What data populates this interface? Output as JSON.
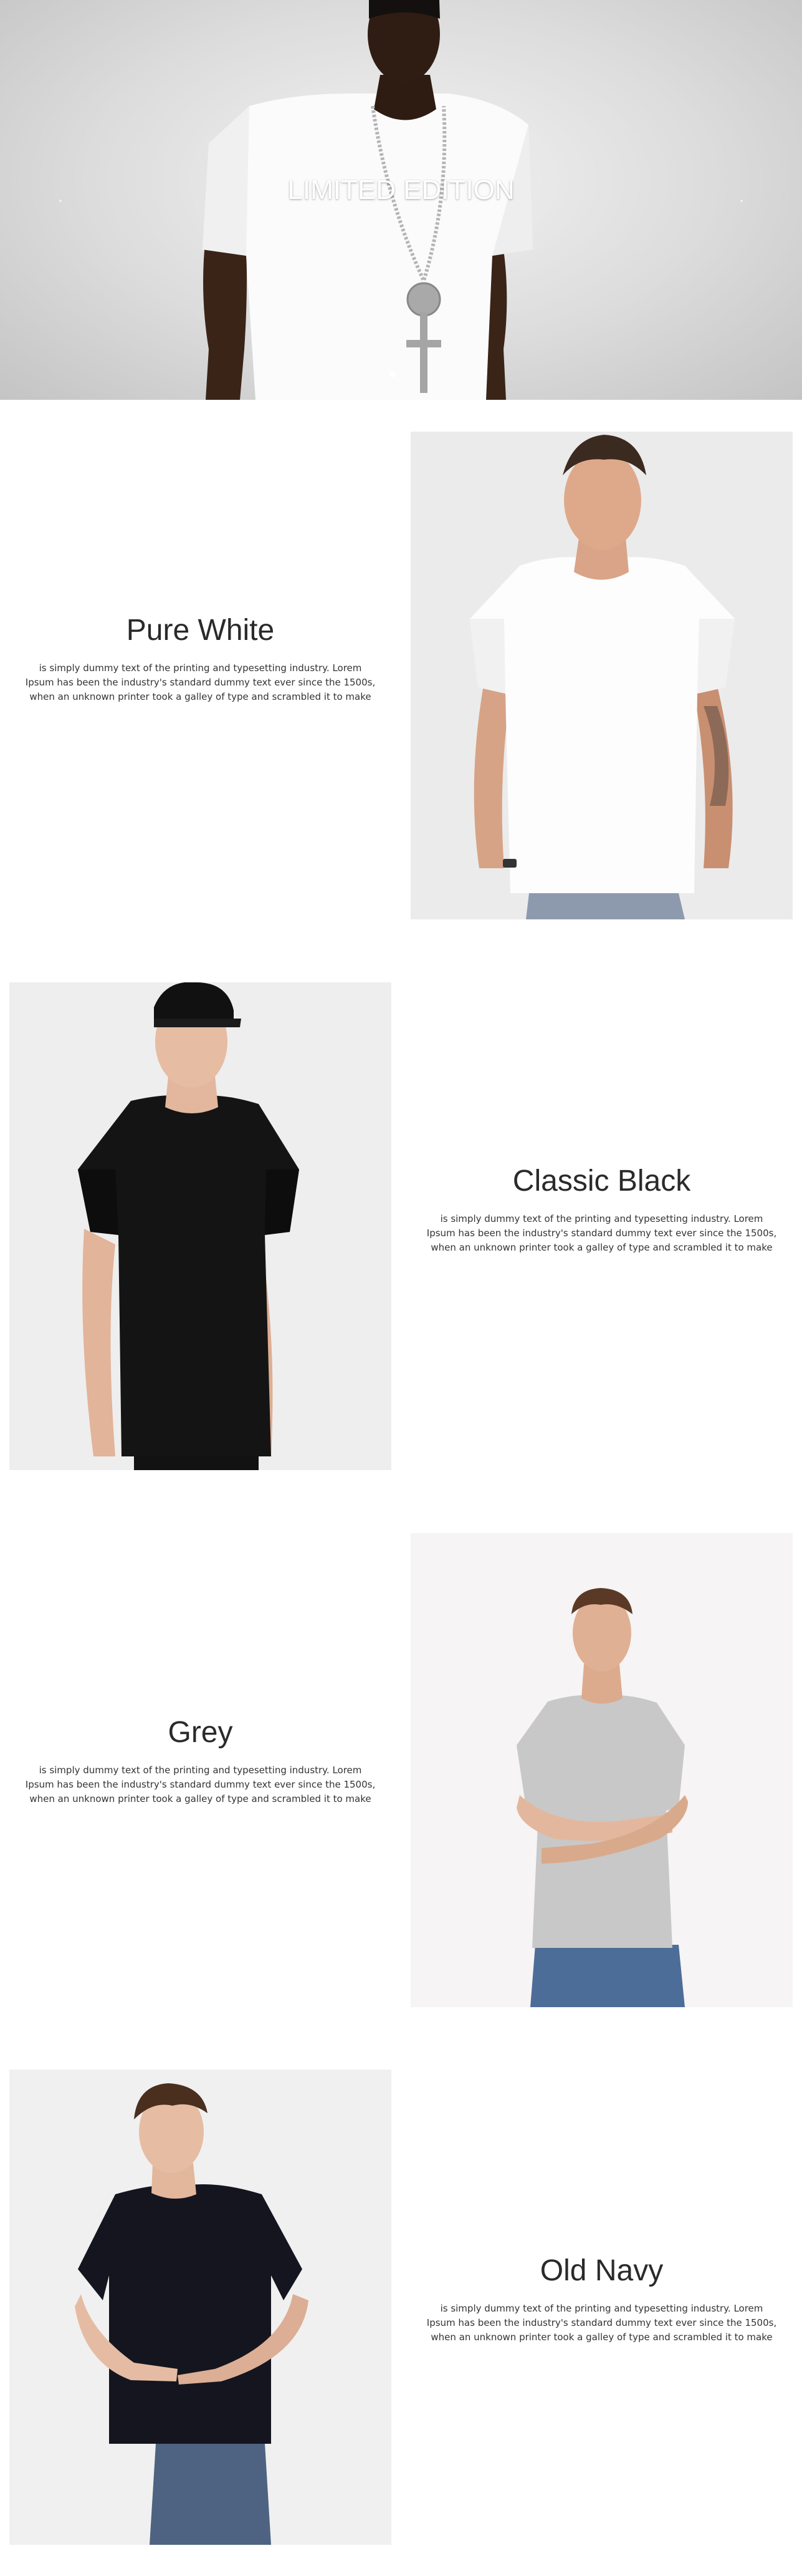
{
  "hero": {
    "title": "LIMITED EDITION",
    "slide_count": 1,
    "active_slide": 1
  },
  "products": [
    {
      "title": "Pure White",
      "description": "is simply dummy text of the printing and typesetting industry. Lorem Ipsum has been the industry's standard dummy text ever since the 1500s, when an unknown printer took a galley of type and scrambled it to make",
      "shirt_color": "#ffffff"
    },
    {
      "title": "Classic Black",
      "description": "is simply dummy text of the printing and typesetting industry. Lorem Ipsum has been the industry's standard dummy text ever since the 1500s, when an unknown printer took a galley of type and scrambled it to make",
      "shirt_color": "#141414"
    },
    {
      "title": "Grey",
      "description": "is simply dummy text of the printing and typesetting industry. Lorem Ipsum has been the industry's standard dummy text ever since the 1500s, when an unknown printer took a galley of type and scrambled it to make",
      "shirt_color": "#c9c9c9"
    },
    {
      "title": "Old Navy",
      "description": "is simply dummy text of the printing and typesetting industry. Lorem Ipsum has been the industry's standard dummy text ever since the 1500s, when an unknown printer took a galley of type and scrambled it to make",
      "shirt_color": "#14151f"
    }
  ]
}
